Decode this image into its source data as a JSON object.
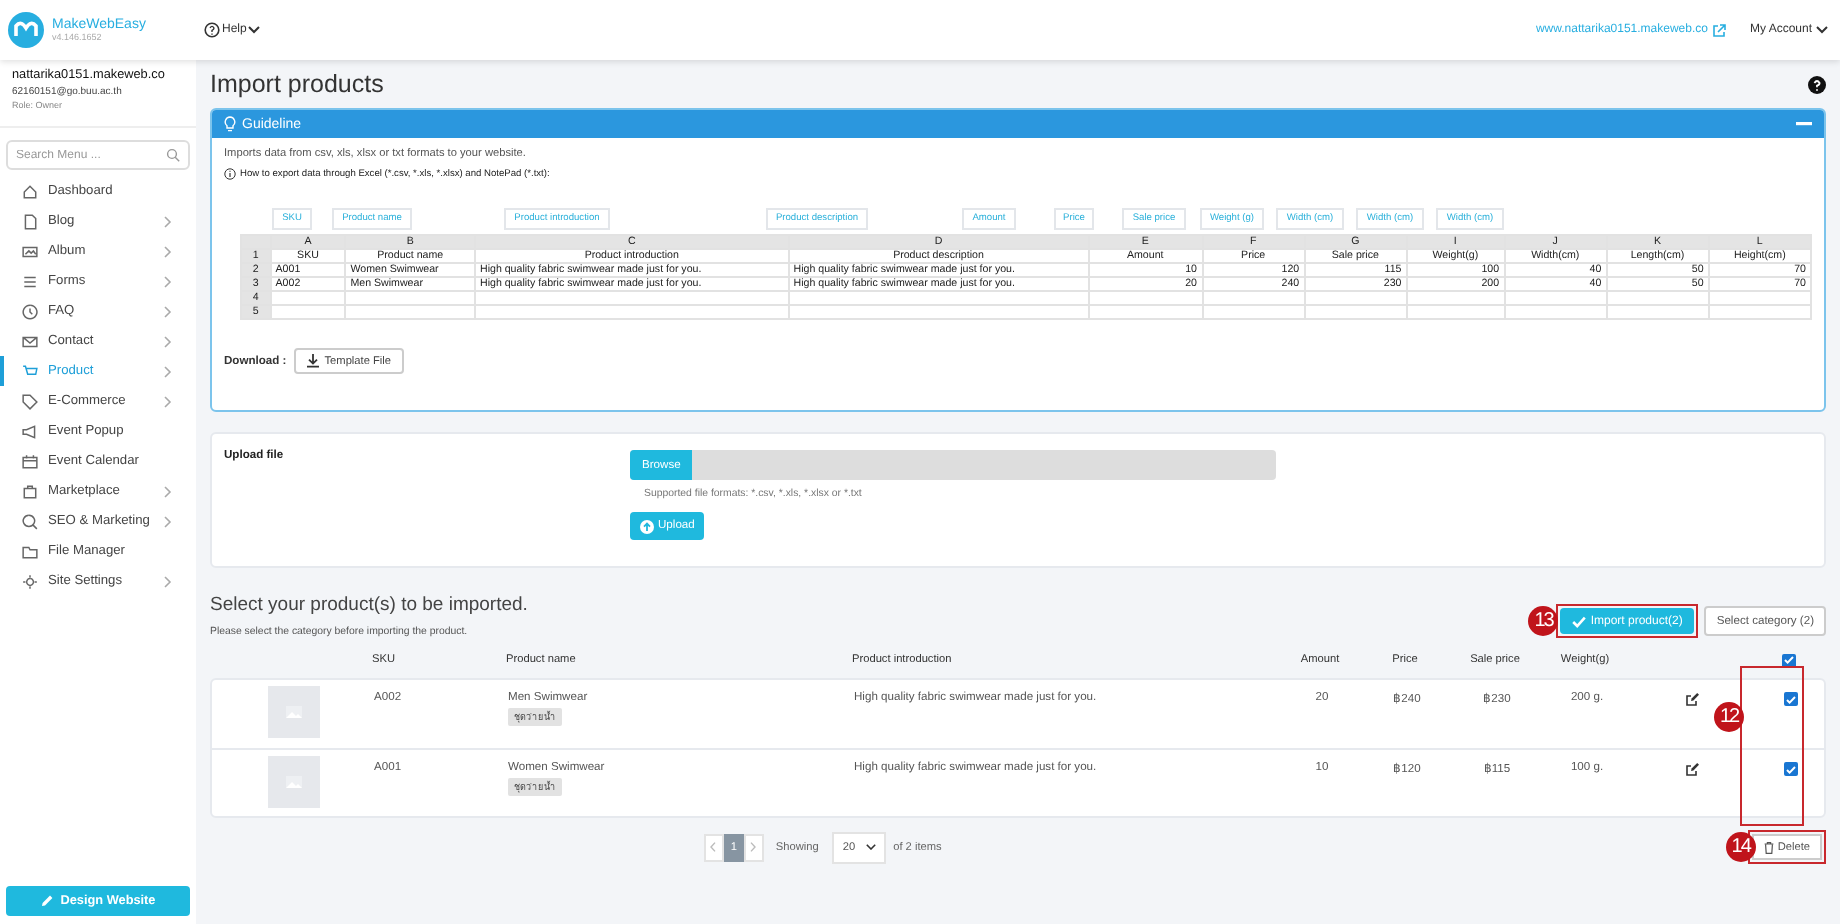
{
  "brand": {
    "name": "MakeWebEasy",
    "version": "v4.146.1652"
  },
  "topbar": {
    "help": "Help",
    "site_link": "www.nattarika0151.makeweb.co",
    "account": "My Account"
  },
  "user": {
    "site": "nattarika0151.makeweb.co",
    "email": "62160151@go.buu.ac.th",
    "role": "Role: Owner"
  },
  "sidebar": {
    "search_placeholder": "Search Menu ...",
    "items": [
      {
        "label": "Dashboard",
        "selected": false,
        "submenu": false
      },
      {
        "label": "Blog",
        "selected": false,
        "submenu": true
      },
      {
        "label": "Album",
        "selected": false,
        "submenu": true
      },
      {
        "label": "Forms",
        "selected": false,
        "submenu": true
      },
      {
        "label": "FAQ",
        "selected": false,
        "submenu": true
      },
      {
        "label": "Contact",
        "selected": false,
        "submenu": true
      },
      {
        "label": "Product",
        "selected": true,
        "submenu": true
      },
      {
        "label": "E-Commerce",
        "selected": false,
        "submenu": true
      },
      {
        "label": "Event Popup",
        "selected": false,
        "submenu": false
      },
      {
        "label": "Event Calendar",
        "selected": false,
        "submenu": false
      },
      {
        "label": "Marketplace",
        "selected": false,
        "submenu": true
      },
      {
        "label": "SEO & Marketing",
        "selected": false,
        "submenu": true
      },
      {
        "label": "File Manager",
        "selected": false,
        "submenu": false
      },
      {
        "label": "Site Settings",
        "selected": false,
        "submenu": true
      }
    ],
    "design_button": "Design Website"
  },
  "page_title": "Import products",
  "guideline": {
    "title": "Guideline",
    "intro": "Imports data from csv, xls, xlsx or txt formats to your website.",
    "howto": "How to export data through Excel (*.csv, *.xls, *.xlsx) and NotePad (*.txt):",
    "callouts": [
      "SKU",
      "Product name",
      "Product introduction",
      "Product description",
      "Amount",
      "Price",
      "Sale price",
      "Weight (g)",
      "Width (cm)",
      "Width (cm)",
      "Width (cm)"
    ],
    "sheet": {
      "letters": [
        "A",
        "B",
        "C",
        "D",
        "E",
        "F",
        "G",
        "I",
        "J",
        "K",
        "L"
      ],
      "rows": [
        {
          "number": "1",
          "cells": [
            "SKU",
            "Product name",
            "Product introduction",
            "Product description",
            "Amount",
            "Price",
            "Sale price",
            "Weight(g)",
            "Width(cm)",
            "Length(cm)",
            "Height(cm)"
          ]
        },
        {
          "number": "2",
          "cells": [
            "A001",
            "Women Swimwear",
            "High quality fabric swimwear made just for you.",
            "High quality fabric swimwear made just for you.",
            "10",
            "120",
            "115",
            "100",
            "40",
            "50",
            "70"
          ]
        },
        {
          "number": "3",
          "cells": [
            "A002",
            "Men Swimwear",
            "High quality fabric swimwear made just for you.",
            "High quality fabric swimwear made just for you.",
            "20",
            "240",
            "230",
            "200",
            "40",
            "50",
            "70"
          ]
        },
        {
          "number": "4",
          "cells": []
        },
        {
          "number": "5",
          "cells": []
        }
      ]
    },
    "download_label": "Download :",
    "template_button": "Template File"
  },
  "upload": {
    "label": "Upload file",
    "browse": "Browse",
    "formats": "Supported file formats: *.csv, *.xls, *.xlsx or *.txt",
    "upload_button": "Upload"
  },
  "products": {
    "heading": "Select your product(s) to be imported.",
    "note": "Please select the category before importing the product.",
    "import_button": "Import product(2)",
    "category_button": "Select category (2)",
    "columns": [
      "SKU",
      "Product name",
      "Product introduction",
      "Amount",
      "Price",
      "Sale price",
      "Weight(g)"
    ],
    "all_checked": true,
    "rows": [
      {
        "sku": "A002",
        "name": "Men Swimwear",
        "tag": "ชุดว่ายน้ำ",
        "intro": "High quality fabric swimwear made just for you.",
        "amount": "20",
        "price": "฿240",
        "sale_price": "฿230",
        "weight": "200 g.",
        "checked": true
      },
      {
        "sku": "A001",
        "name": "Women Swimwear",
        "tag": "ชุดว่ายน้ำ",
        "intro": "High quality fabric swimwear made just for you.",
        "amount": "10",
        "price": "฿120",
        "sale_price": "฿115",
        "weight": "100 g.",
        "checked": true
      }
    ],
    "pages": [
      {
        "label": "1",
        "selected": true
      }
    ],
    "showing": "Showing",
    "per_page": "20",
    "of_items": "of 2 items",
    "delete_button": "Delete"
  },
  "annotations": [
    "13",
    "12",
    "14"
  ]
}
